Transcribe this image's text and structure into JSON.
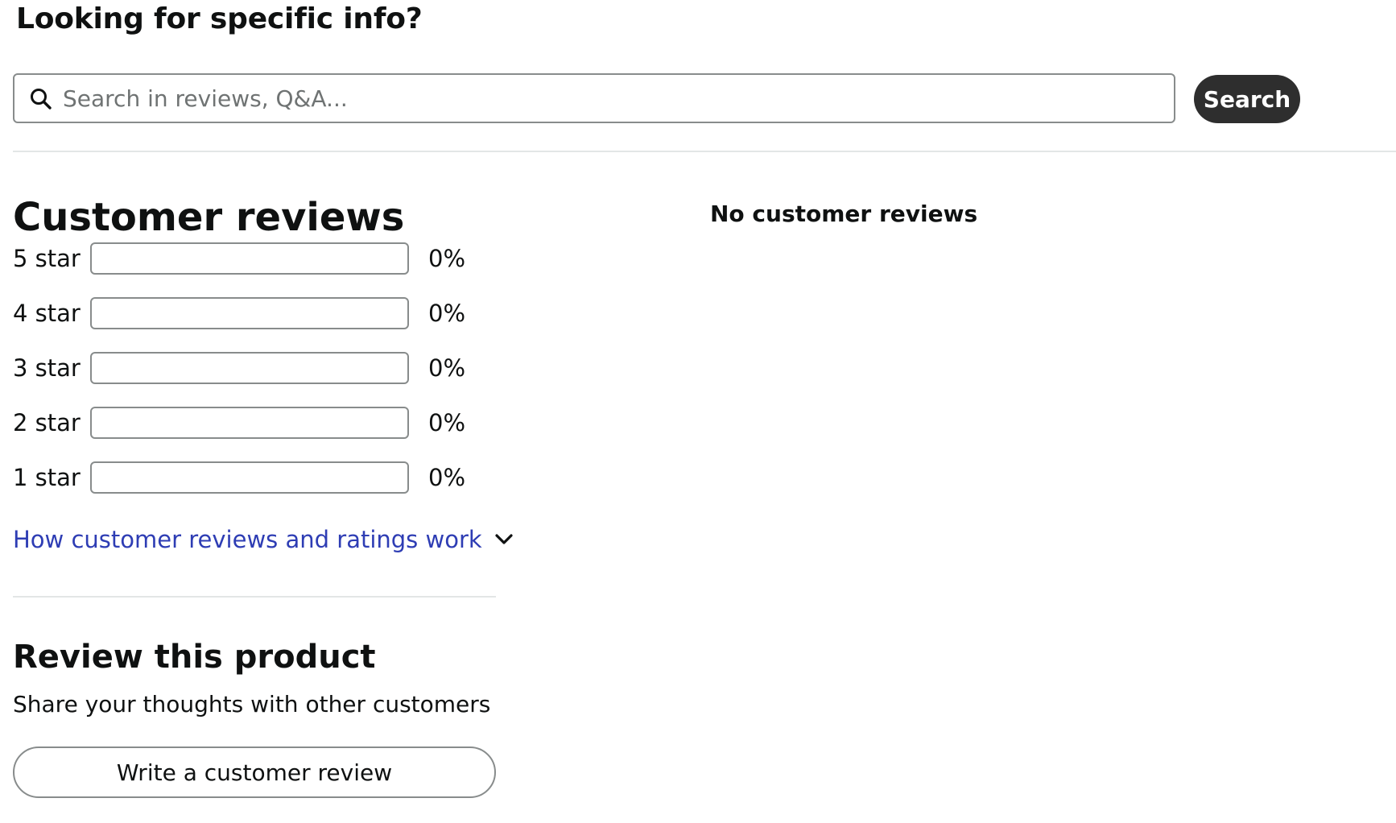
{
  "search_section": {
    "heading": "Looking for specific info?",
    "placeholder": "Search in reviews, Q&A...",
    "value": "",
    "search_label": "Search"
  },
  "reviews": {
    "title": "Customer reviews",
    "no_reviews_text": "No customer reviews",
    "rating_rows": [
      {
        "label": "5 star",
        "percent_text": "0%",
        "fraction": 0
      },
      {
        "label": "4 star",
        "percent_text": "0%",
        "fraction": 0
      },
      {
        "label": "3 star",
        "percent_text": "0%",
        "fraction": 0
      },
      {
        "label": "2 star",
        "percent_text": "0%",
        "fraction": 0
      },
      {
        "label": "1 star",
        "percent_text": "0%",
        "fraction": 0
      }
    ],
    "how_it_works_link": "How customer reviews and ratings work"
  },
  "review_product": {
    "title": "Review this product",
    "subtitle": "Share your thoughts with other customers",
    "write_review_label": "Write a customer review"
  },
  "colors": {
    "link": "#2e3db4",
    "bar_border": "#888c8c",
    "bar_fill": "#de7921",
    "search_button_bg": "#2e2e2e"
  },
  "icons": {
    "search": "search-icon",
    "expand": "chevron-down-icon"
  }
}
